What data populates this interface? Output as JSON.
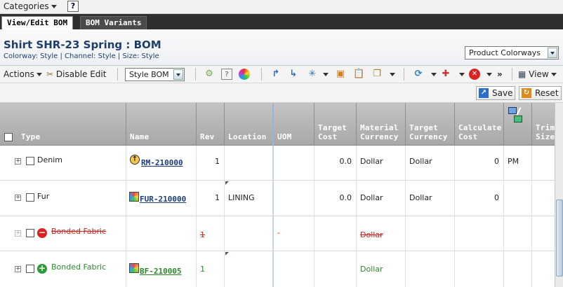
{
  "topbar": {
    "categories_label": "Categories",
    "help_label": "?"
  },
  "tabs": [
    {
      "label": "View/Edit BOM",
      "active": true
    },
    {
      "label": "BOM Variants",
      "active": false
    }
  ],
  "page": {
    "title": "Shirt SHR-23 Spring : BOM",
    "subtitle": "Colorway: Style | Channel: Style | Size: Style",
    "colorway_select": "Product Colorways"
  },
  "toolbar": {
    "actions_label": "Actions",
    "disable_edit_label": "Disable Edit",
    "style_bom_select": "Style BOM",
    "more_label": "»",
    "view_label": "View"
  },
  "actionbar": {
    "save_label": "Save",
    "reset_label": "Reset"
  },
  "grid": {
    "columns": [
      {
        "key": "type",
        "label": "Type"
      },
      {
        "key": "name",
        "label": "Name"
      },
      {
        "key": "rev",
        "label": "Rev"
      },
      {
        "key": "location",
        "label": "Location"
      },
      {
        "key": "uom",
        "label": "UOM"
      },
      {
        "key": "target_cost",
        "label": "Target\nCost"
      },
      {
        "key": "material_currency",
        "label": "Material\nCurrency"
      },
      {
        "key": "target_currency",
        "label": "Target\nCurrency"
      },
      {
        "key": "calculate_cost",
        "label": "Calculate\nCost"
      },
      {
        "key": "pm",
        "label": ""
      },
      {
        "key": "trim_size",
        "label": "Trim\nSize"
      }
    ],
    "rows": [
      {
        "type": "Denim",
        "name": "RM-210000",
        "rev": "1",
        "location": "",
        "uom": "",
        "target_cost": "0.0",
        "material_currency": "Dollar",
        "target_currency": "Dollar",
        "calculate_cost": "0",
        "pm": "PM",
        "trim_size": "",
        "state": "normal"
      },
      {
        "type": "Fur",
        "name": "FUR-210000",
        "rev": "1",
        "location": "LINING",
        "uom": "",
        "target_cost": "0.0",
        "material_currency": "Dollar",
        "target_currency": "Dollar",
        "calculate_cost": "0",
        "pm": "",
        "trim_size": "",
        "state": "normal"
      },
      {
        "type": "Bonded Fabric",
        "name": "",
        "rev": "1",
        "location": "",
        "uom": "-",
        "target_cost": "",
        "material_currency": "Dollar",
        "target_currency": "",
        "calculate_cost": "",
        "pm": "",
        "trim_size": "",
        "state": "removed"
      },
      {
        "type": "Bonded Fabric",
        "name": "BF-210005",
        "rev": "1",
        "location": "",
        "uom": "",
        "target_cost": "",
        "material_currency": "Dollar",
        "target_currency": "",
        "calculate_cost": "",
        "pm": "",
        "trim_size": "",
        "state": "added"
      }
    ]
  },
  "colors": {
    "header_bg": "#b6b6b6",
    "tab_bar": "#2f2f2f",
    "title_color": "#1f3f6a",
    "removed": "#cc2222",
    "added": "#2a8a2a"
  }
}
